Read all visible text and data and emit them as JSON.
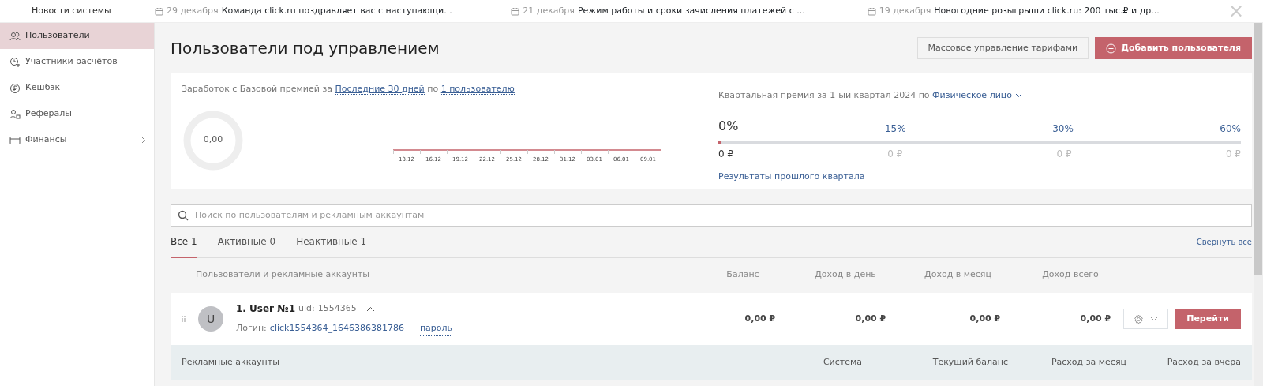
{
  "news_bar": {
    "title": "Новости системы",
    "items": [
      {
        "date": "29 декабря",
        "text": "Команда click.ru поздравляет вас с наступающи..."
      },
      {
        "date": "21 декабря",
        "text": "Режим работы и сроки зачисления платежей с ..."
      },
      {
        "date": "19 декабря",
        "text": "Новогодние розыгрыши click.ru: 200 тыс.₽ и др..."
      }
    ],
    "close": "×"
  },
  "sidebar": {
    "items": [
      {
        "kind": "users",
        "label": "Пользователи",
        "selected": true,
        "expandable": false
      },
      {
        "kind": "participants",
        "label": "Участники расчётов",
        "selected": false,
        "expandable": false
      },
      {
        "kind": "cashback",
        "label": "Кешбэк",
        "selected": false,
        "expandable": false
      },
      {
        "kind": "referrals",
        "label": "Рефералы",
        "selected": false,
        "expandable": false
      },
      {
        "kind": "finance",
        "label": "Финансы",
        "selected": false,
        "expandable": true
      }
    ]
  },
  "page": {
    "title": "Пользователи под управлением",
    "buttons": [
      {
        "kind": "secondary",
        "label": "Массовое управление тарифами"
      },
      {
        "kind": "primary",
        "label": "Добавить пользователя"
      }
    ]
  },
  "earnings": {
    "prefix": "Заработок с Базовой премией за",
    "period": "Последние 30 дней",
    "joiner": "по",
    "users": "1 пользователю",
    "total": "0,00",
    "x_labels": [
      "13.12",
      "16.12",
      "19.12",
      "22.12",
      "25.12",
      "28.12",
      "31.12",
      "03.01",
      "06.01",
      "09.01"
    ]
  },
  "quarterly": {
    "prefix": "Квартальная премия за 1-ый квартал 2024 по",
    "entity": "Физическое лицо",
    "level": 0,
    "steps": [
      {
        "percent": "0%",
        "amount": "0 ₽",
        "reached": true
      },
      {
        "percent": "15%",
        "amount": "0 ₽",
        "reached": false
      },
      {
        "percent": "30%",
        "amount": "0 ₽",
        "reached": false
      },
      {
        "percent": "60%",
        "amount": "0 ₽",
        "reached": false
      }
    ],
    "link": "Результаты прошлого квартала"
  },
  "search": {
    "placeholder": "Поиск по пользователям и рекламным аккаунтам"
  },
  "tabs": [
    {
      "label": "Все 1",
      "selected": true
    },
    {
      "label": "Активные 0",
      "selected": false
    },
    {
      "label": "Неактивные 1",
      "selected": false
    }
  ],
  "collapse_all": "Свернуть все",
  "table": {
    "columns": [
      "Пользователи и рекламные аккаунты",
      "Баланс",
      "Доход в день",
      "Доход в месяц",
      "Доход всего"
    ],
    "rows": [
      {
        "avatar": "U",
        "name": "1. User №1",
        "uid_label": "uid:",
        "uid": "1554365",
        "expanded": true,
        "login_label": "Логин:",
        "login": "click1554364_1646386381786",
        "password": "пароль",
        "balance": "0,00 ₽",
        "day": "0,00 ₽",
        "month": "0,00 ₽",
        "total": "0,00 ₽",
        "go": "Перейти"
      }
    ]
  },
  "accounts_header": [
    "Рекламные аккаунты",
    "Система",
    "Текущий баланс",
    "Расход за месяц",
    "Расход за вчера"
  ]
}
